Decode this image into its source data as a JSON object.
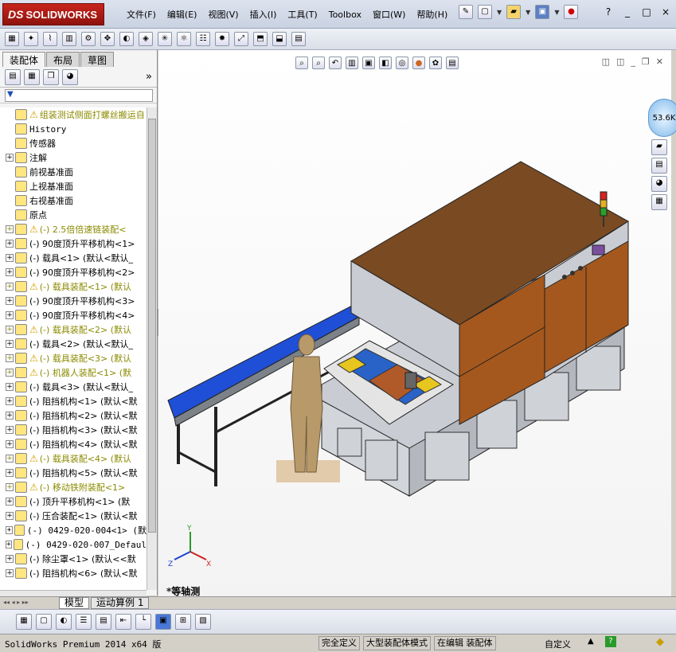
{
  "app": {
    "logo_ds": "DS",
    "logo_text": "SOLIDWORKS"
  },
  "menu": [
    "文件(F)",
    "编辑(E)",
    "视图(V)",
    "插入(I)",
    "工具(T)",
    "Toolbox",
    "窗口(W)",
    "帮助(H)"
  ],
  "window_controls": [
    "?",
    "_",
    "□",
    "×"
  ],
  "feature_tabs": [
    "装配体",
    "布局",
    "草图"
  ],
  "panel_expand": "»",
  "tree": [
    {
      "label": "组装测试侧面打螺丝搬运自",
      "warn": true,
      "exp": false,
      "olive": true
    },
    {
      "label": "History",
      "exp": false,
      "mono": true
    },
    {
      "label": "传感器",
      "exp": false
    },
    {
      "label": "注解",
      "exp": true
    },
    {
      "label": "前视基准面",
      "exp": false
    },
    {
      "label": "上视基准面",
      "exp": false
    },
    {
      "label": "右视基准面",
      "exp": false
    },
    {
      "label": "原点",
      "exp": false
    },
    {
      "label": "(-) 2.5倍倍速链装配<",
      "exp": true,
      "warn": true,
      "olive": true
    },
    {
      "label": "(-) 90度顶升平移机构<1>",
      "exp": true
    },
    {
      "label": "(-) 载具<1> (默认<默认_",
      "exp": true
    },
    {
      "label": "(-) 90度顶升平移机构<2>",
      "exp": true
    },
    {
      "label": "(-) 载具装配<1> (默认",
      "exp": true,
      "warn": true,
      "olive": true
    },
    {
      "label": "(-) 90度顶升平移机构<3>",
      "exp": true
    },
    {
      "label": "(-) 90度顶升平移机构<4>",
      "exp": true
    },
    {
      "label": "(-) 载具装配<2> (默认",
      "exp": true,
      "warn": true,
      "olive": true
    },
    {
      "label": "(-) 载具<2> (默认<默认_",
      "exp": true
    },
    {
      "label": "(-) 载具装配<3> (默认",
      "exp": true,
      "warn": true,
      "olive": true
    },
    {
      "label": "(-) 机器人装配<1> (默",
      "exp": true,
      "warn": true,
      "olive": true
    },
    {
      "label": "(-) 载具<3> (默认<默认_",
      "exp": true
    },
    {
      "label": "(-) 阻挡机构<1> (默认<默",
      "exp": true
    },
    {
      "label": "(-) 阻挡机构<2> (默认<默",
      "exp": true
    },
    {
      "label": "(-) 阻挡机构<3> (默认<默",
      "exp": true
    },
    {
      "label": "(-) 阻挡机构<4> (默认<默",
      "exp": true
    },
    {
      "label": "(-) 载具装配<4> (默认",
      "exp": true,
      "warn": true,
      "olive": true
    },
    {
      "label": "(-) 阻挡机构<5> (默认<默",
      "exp": true
    },
    {
      "label": "(-) 移动铁附装配<1>",
      "exp": true,
      "warn": true,
      "olive": true
    },
    {
      "label": "(-) 顶升平移机构<1> (默",
      "exp": true
    },
    {
      "label": "(-) 压合装配<1> (默认<默",
      "exp": true
    },
    {
      "label": "(-) 0429-020-004<1> (默",
      "exp": true,
      "mono": true
    },
    {
      "label": "(-) 0429-020-007_Defaul",
      "exp": true,
      "mono": true
    },
    {
      "label": "(-) 除尘罩<1> (默认<<默",
      "exp": true
    },
    {
      "label": "(-) 阻挡机构<6> (默认<默",
      "exp": true
    }
  ],
  "viewport": {
    "badge": "53.6K",
    "view_label": "*等轴测"
  },
  "triad": {
    "x": "X",
    "y": "Y",
    "z": "Z"
  },
  "bottom_tabs": [
    "模型",
    "运动算例 1"
  ],
  "status": {
    "version": "SolidWorks Premium 2014 x64 版",
    "cells": [
      "完全定义",
      "大型装配体模式",
      "在编辑 装配体"
    ],
    "custom": "自定义"
  },
  "colors": {
    "brand": "#c8241c",
    "conveyor": "#1f4fd6",
    "frame": "#8a8f96",
    "cabinet_top": "#7a4a22",
    "cabinet_door": "#a5581d"
  }
}
